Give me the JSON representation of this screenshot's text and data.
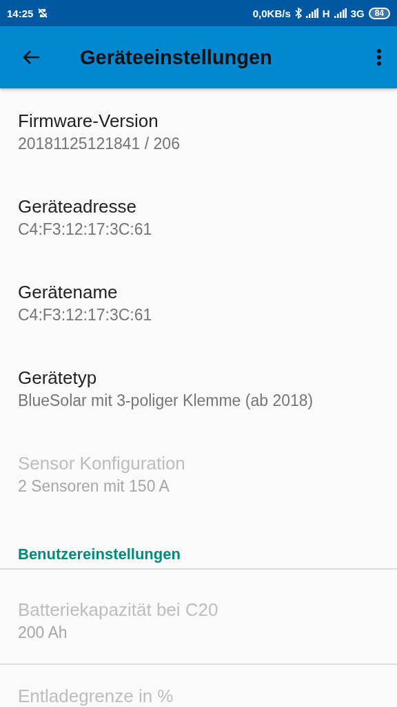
{
  "status_bar": {
    "time": "14:25",
    "data_rate": "0,0KB/s",
    "network_1": "H",
    "network_2": "3G",
    "battery": "84"
  },
  "app_bar": {
    "title": "Geräteeinstellungen"
  },
  "sections": [
    {
      "items": [
        {
          "title": "Firmware-Version",
          "summary": "20181125121841 / 206",
          "disabled": false
        },
        {
          "title": "Geräteadresse",
          "summary": "C4:F3:12:17:3C:61",
          "disabled": false
        },
        {
          "title": "Gerätename",
          "summary": "C4:F3:12:17:3C:61",
          "disabled": false
        },
        {
          "title": "Gerätetyp",
          "summary": "BlueSolar mit 3-poliger Klemme (ab 2018)",
          "disabled": false
        },
        {
          "title": "Sensor Konfiguration",
          "summary": "2 Sensoren mit 150 A",
          "disabled": true
        }
      ]
    },
    {
      "header": "Benutzereinstellungen",
      "items": [
        {
          "title": "Batteriekapazität bei C20",
          "summary": "200 Ah",
          "disabled": true
        },
        {
          "title": "Entladegrenze in %",
          "disabled": true
        }
      ]
    }
  ]
}
